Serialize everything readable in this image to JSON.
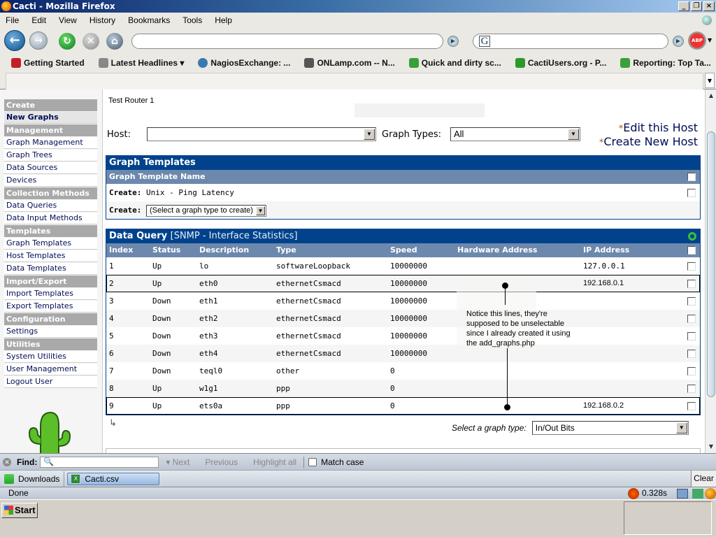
{
  "window": {
    "title": "Cacti - Mozilla Firefox"
  },
  "menu": [
    "File",
    "Edit",
    "View",
    "History",
    "Bookmarks",
    "Tools",
    "Help"
  ],
  "navbar": {
    "url_value": "",
    "search_value": "",
    "abp_label": "ABP"
  },
  "bookmarks": [
    {
      "label": "Getting Started",
      "icon": "firefox-bookmark-icon",
      "color": "#c0202a"
    },
    {
      "label": "Latest Headlines ▾",
      "icon": "rss-icon",
      "color": "#888888"
    },
    {
      "label": "NagiosExchange: ...",
      "icon": "globe-icon",
      "color": "#3a7ab0"
    },
    {
      "label": "ONLamp.com -- N...",
      "icon": "onlamp-icon",
      "color": "#555555"
    },
    {
      "label": "Quick and dirty sc...",
      "icon": "cacti-icon",
      "color": "#3aa03a"
    },
    {
      "label": "CactiUsers.org - P...",
      "icon": "cactiusers-icon",
      "color": "#2a9a2a"
    },
    {
      "label": "Reporting: Top Ta...",
      "icon": "cacti-icon",
      "color": "#3aa03a"
    }
  ],
  "sidebar": [
    {
      "type": "head",
      "label": "Create"
    },
    {
      "type": "item",
      "label": "New Graphs",
      "active": true
    },
    {
      "type": "head",
      "label": "Management"
    },
    {
      "type": "item",
      "label": "Graph Management"
    },
    {
      "type": "item",
      "label": "Graph Trees"
    },
    {
      "type": "item",
      "label": "Data Sources"
    },
    {
      "type": "item",
      "label": "Devices"
    },
    {
      "type": "head",
      "label": "Collection Methods"
    },
    {
      "type": "item",
      "label": "Data Queries"
    },
    {
      "type": "item",
      "label": "Data Input Methods"
    },
    {
      "type": "head",
      "label": "Templates"
    },
    {
      "type": "item",
      "label": "Graph Templates"
    },
    {
      "type": "item",
      "label": "Host Templates"
    },
    {
      "type": "item",
      "label": "Data Templates"
    },
    {
      "type": "head",
      "label": "Import/Export"
    },
    {
      "type": "item",
      "label": "Import Templates"
    },
    {
      "type": "item",
      "label": "Export Templates"
    },
    {
      "type": "head",
      "label": "Configuration"
    },
    {
      "type": "item",
      "label": "Settings"
    },
    {
      "type": "head",
      "label": "Utilities"
    },
    {
      "type": "item",
      "label": "System Utilities"
    },
    {
      "type": "item",
      "label": "User Management"
    },
    {
      "type": "item",
      "label": "Logout User"
    }
  ],
  "main": {
    "host_name": "Test Router 1",
    "host_label": "Host:",
    "host_value": "",
    "graph_types_label": "Graph Types:",
    "graph_types_value": "All",
    "edit_host": "Edit this Host",
    "create_host": "Create New Host",
    "star": "*"
  },
  "graph_templates": {
    "title": "Graph Templates",
    "column": "Graph Template Name",
    "create_label": "Create:",
    "row1": "Unix - Ping Latency",
    "select_placeholder": "(Select a graph type to create)"
  },
  "data_query": {
    "title": "Data Query",
    "subtitle": "[SNMP - Interface Statistics]",
    "columns": [
      "Index",
      "Status",
      "Description",
      "Type",
      "Speed",
      "Hardware Address",
      "IP Address"
    ],
    "rows": [
      {
        "index": "1",
        "status": "Up",
        "description": "lo",
        "type": "softwareLoopback",
        "speed": "10000000",
        "hw": "",
        "ip": "127.0.0.1"
      },
      {
        "index": "2",
        "status": "Up",
        "description": "eth0",
        "type": "ethernetCsmacd",
        "speed": "10000000",
        "hw": "",
        "ip": "192.168.0.1",
        "highlighted": true
      },
      {
        "index": "3",
        "status": "Down",
        "description": "eth1",
        "type": "ethernetCsmacd",
        "speed": "10000000",
        "hw": "",
        "ip": ""
      },
      {
        "index": "4",
        "status": "Down",
        "description": "eth2",
        "type": "ethernetCsmacd",
        "speed": "10000000",
        "hw": "",
        "ip": ""
      },
      {
        "index": "5",
        "status": "Down",
        "description": "eth3",
        "type": "ethernetCsmacd",
        "speed": "10000000",
        "hw": "",
        "ip": ""
      },
      {
        "index": "6",
        "status": "Down",
        "description": "eth4",
        "type": "ethernetCsmacd",
        "speed": "10000000",
        "hw": "",
        "ip": ""
      },
      {
        "index": "7",
        "status": "Down",
        "description": "teql0",
        "type": "other",
        "speed": "0",
        "hw": "",
        "ip": ""
      },
      {
        "index": "8",
        "status": "Up",
        "description": "w1g1",
        "type": "ppp",
        "speed": "0",
        "hw": "",
        "ip": ""
      },
      {
        "index": "9",
        "status": "Up",
        "description": "ets0a",
        "type": "ppp",
        "speed": "0",
        "hw": "",
        "ip": "192.168.0.2",
        "highlighted": true
      }
    ],
    "select_graph_type_label": "Select a graph type:",
    "select_graph_type_value": "In/Out Bits"
  },
  "annotation": "Notice this lines, they're supposed to be unselectable since I already created it using the add_graphs.php",
  "findbar": {
    "label": "Find:",
    "value": "",
    "next": "Next",
    "previous": "Previous",
    "highlight": "Highlight all",
    "match_case": "Match case"
  },
  "downloads": {
    "label": "Downloads",
    "file": "Cacti.csv",
    "clear": "Clear"
  },
  "status": {
    "text": "Done",
    "timing": "0.328s"
  },
  "taskbar": {
    "start": "Start"
  }
}
